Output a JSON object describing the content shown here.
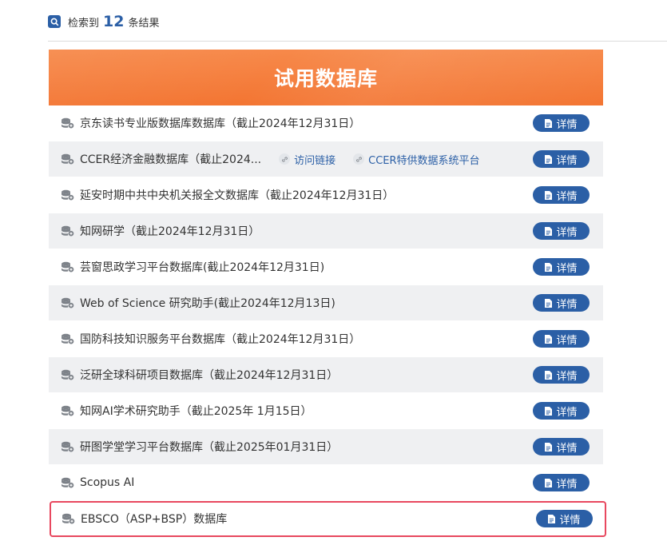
{
  "search": {
    "prefix": "检索到",
    "count": "12",
    "suffix": "条结果"
  },
  "banner": {
    "title": "试用数据库"
  },
  "detail_label": "详情",
  "rows": [
    {
      "title": "京东读书专业版数据库数据库（截止2024年12月31日）"
    },
    {
      "title": "CCER经济金融数据库（截止2024...",
      "links": [
        "访问链接",
        "CCER特供数据系统平台"
      ]
    },
    {
      "title": "延安时期中共中央机关报全文数据库（截止2024年12月31日）"
    },
    {
      "title": "知网研学（截止2024年12月31日）"
    },
    {
      "title": "芸窗思政学习平台数据库(截止2024年12月31日)"
    },
    {
      "title": "Web of Science 研究助手(截止2024年12月13日)"
    },
    {
      "title": "国防科技知识服务平台数据库（截止2024年12月31日）"
    },
    {
      "title": "泛研全球科研项目数据库（截止2024年12月31日）"
    },
    {
      "title": "知网AI学术研究助手（截止2025年 1月15日）"
    },
    {
      "title": "研图学堂学习平台数据库（截止2025年01月31日）"
    },
    {
      "title": "Scopus AI"
    },
    {
      "title": "EBSCO（ASP+BSP）数据库"
    }
  ],
  "colors": {
    "accent": "#2b5fa6",
    "banner": "#f47b35",
    "highlight_border": "#e8485f"
  }
}
